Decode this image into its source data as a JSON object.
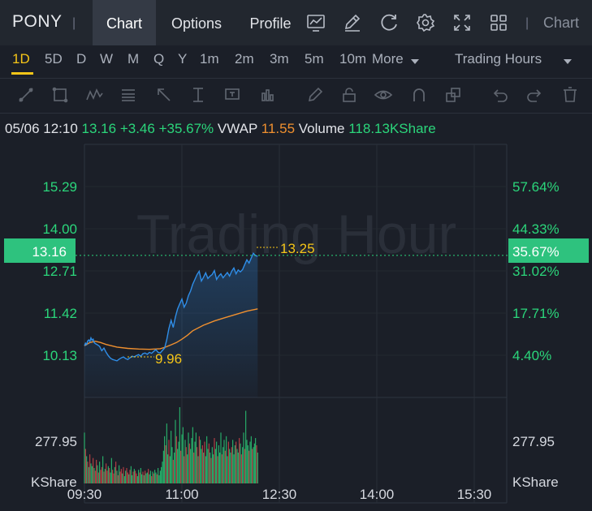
{
  "header": {
    "ticker": "PONY",
    "separator": "|",
    "tabs": [
      {
        "label": "Chart",
        "active": true
      },
      {
        "label": "Options",
        "active": false
      },
      {
        "label": "Profile",
        "active": false
      }
    ],
    "toolbar_icons": [
      "chart-indicator-icon",
      "draw-pen-icon",
      "refresh-icon",
      "settings-gear-icon",
      "fullscreen-icon",
      "layout-grid-icon"
    ],
    "right_separator": "|",
    "right_label": "Chart"
  },
  "periods": {
    "items": [
      "1D",
      "5D",
      "D",
      "W",
      "M",
      "Q",
      "Y",
      "1m",
      "2m",
      "3m",
      "5m",
      "10m"
    ],
    "active": "1D",
    "more_label": "More",
    "session_label": "Trading Hours"
  },
  "draw_tools": [
    "trend-line-icon",
    "rectangle-icon",
    "wave-pattern-icon",
    "fibonacci-icon",
    "arrow-icon",
    "price-range-icon",
    "text-note-icon",
    "measure-icon",
    "pencil-icon",
    "lock-icon",
    "visibility-eye-icon",
    "magnet-icon",
    "clone-icon",
    "undo-icon",
    "redo-icon",
    "trash-icon"
  ],
  "quote": {
    "datetime": "05/06 12:10",
    "price": "13.16",
    "change": "+3.46",
    "change_pct": "+35.67%",
    "vwap_label": "VWAP",
    "vwap_value": "11.55",
    "volume_label": "Volume",
    "volume_value": "118.13KShare"
  },
  "colors": {
    "up": "#2bd67b",
    "down": "#e0474b",
    "price_line": "#2f8ee8",
    "vwap_line": "#f0902f",
    "annotation": "#f5c518",
    "watermark": "#2a2f39"
  },
  "chart_data": {
    "type": "line",
    "watermark": "Trading Hour",
    "y_ticks_left": [
      "15.29",
      "14.00",
      "12.71",
      "11.42",
      "10.13"
    ],
    "y_ticks_right": [
      "57.64%",
      "44.33%",
      "31.02%",
      "17.71%",
      "4.40%"
    ],
    "ylim": [
      8.84,
      16.58
    ],
    "current_price_label": "13.16",
    "current_pct_label": "35.67%",
    "high_label": "13.25",
    "low_label": "9.96",
    "x_ticks": [
      "09:30",
      "11:00",
      "12:30",
      "14:00",
      "15:30"
    ],
    "x_range_minutes": [
      570,
      960
    ],
    "series": [
      {
        "name": "price",
        "x": [
          570,
          571,
          572,
          573,
          574,
          575,
          576,
          577,
          578,
          579,
          580,
          582,
          584,
          586,
          588,
          590,
          592,
          594,
          596,
          598,
          600,
          602,
          604,
          606,
          608,
          610,
          612,
          614,
          616,
          618,
          620,
          622,
          624,
          626,
          628,
          630,
          632,
          634,
          636,
          638,
          640,
          642,
          644,
          646,
          648,
          650,
          652,
          654,
          656,
          658,
          660,
          662,
          664,
          666,
          668,
          670,
          672,
          674,
          676,
          678,
          680,
          682,
          684,
          686,
          688,
          690,
          692,
          694,
          696,
          698,
          700,
          702,
          704,
          706,
          708,
          710,
          712,
          714,
          716,
          718,
          720,
          722,
          724,
          726,
          728,
          730
        ],
        "values": [
          10.42,
          10.5,
          10.46,
          10.57,
          10.6,
          10.55,
          10.66,
          10.59,
          10.62,
          10.52,
          10.49,
          10.45,
          10.4,
          10.27,
          10.35,
          10.22,
          10.12,
          10.04,
          10.0,
          9.98,
          9.96,
          10.01,
          10.05,
          10.08,
          10.03,
          10.0,
          10.05,
          10.1,
          10.08,
          10.12,
          10.15,
          10.1,
          10.18,
          10.2,
          10.16,
          10.22,
          10.19,
          10.25,
          10.3,
          10.22,
          10.2,
          10.28,
          10.35,
          10.6,
          10.95,
          11.2,
          10.98,
          11.3,
          11.55,
          11.7,
          11.85,
          11.6,
          11.72,
          11.95,
          12.1,
          12.3,
          12.45,
          12.6,
          12.7,
          12.4,
          12.52,
          12.65,
          12.48,
          12.55,
          12.6,
          12.72,
          12.45,
          12.55,
          12.62,
          12.5,
          12.58,
          12.66,
          12.55,
          12.7,
          12.8,
          12.62,
          12.74,
          12.68,
          12.75,
          12.9,
          13.05,
          12.95,
          13.1,
          13.25,
          13.18,
          13.16
        ]
      },
      {
        "name": "VWAP",
        "x": [
          570,
          575,
          580,
          585,
          590,
          600,
          610,
          620,
          630,
          640,
          645,
          650,
          655,
          660,
          665,
          670,
          680,
          690,
          700,
          710,
          720,
          730
        ],
        "values": [
          10.42,
          10.52,
          10.56,
          10.52,
          10.46,
          10.38,
          10.34,
          10.32,
          10.31,
          10.33,
          10.38,
          10.45,
          10.52,
          10.62,
          10.74,
          10.88,
          11.05,
          11.18,
          11.28,
          11.38,
          11.48,
          11.55
        ]
      }
    ],
    "volume_tick_label": "277.95",
    "volume_unit": "KShare",
    "volume": {
      "x": [
        570,
        571,
        572,
        573,
        574,
        575,
        576,
        577,
        578,
        579,
        580,
        581,
        582,
        583,
        584,
        585,
        586,
        587,
        588,
        589,
        590,
        591,
        592,
        593,
        594,
        595,
        596,
        597,
        598,
        599,
        600,
        601,
        602,
        603,
        604,
        605,
        606,
        607,
        608,
        609,
        610,
        611,
        612,
        613,
        614,
        615,
        616,
        617,
        618,
        619,
        620,
        621,
        622,
        623,
        624,
        625,
        626,
        627,
        628,
        629,
        630,
        631,
        632,
        633,
        634,
        635,
        636,
        637,
        638,
        639,
        640,
        641,
        642,
        643,
        644,
        645,
        646,
        647,
        648,
        649,
        650,
        651,
        652,
        653,
        654,
        655,
        656,
        657,
        658,
        659,
        660,
        661,
        662,
        663,
        664,
        665,
        666,
        667,
        668,
        669,
        670,
        671,
        672,
        673,
        674,
        675,
        676,
        677,
        678,
        679,
        680,
        681,
        682,
        683,
        684,
        685,
        686,
        687,
        688,
        689,
        690,
        691,
        692,
        693,
        694,
        695,
        696,
        697,
        698,
        699,
        700,
        701,
        702,
        703,
        704,
        705,
        706,
        707,
        708,
        709,
        710,
        711,
        712,
        713,
        714,
        715,
        716,
        717,
        718,
        719,
        720,
        721,
        722,
        723,
        724,
        725,
        726,
        727,
        728,
        729,
        730
      ],
      "values": [
        280,
        190,
        150,
        120,
        90,
        160,
        110,
        95,
        140,
        85,
        70,
        130,
        100,
        60,
        120,
        75,
        90,
        150,
        65,
        80,
        110,
        70,
        95,
        85,
        60,
        140,
        75,
        55,
        90,
        120,
        70,
        45,
        100,
        65,
        80,
        55,
        90,
        40,
        70,
        85,
        60,
        50,
        75,
        95,
        45,
        65,
        80,
        70,
        55,
        40,
        75,
        60,
        85,
        50,
        65,
        45,
        70,
        55,
        60,
        80,
        50,
        70,
        40,
        65,
        55,
        75,
        60,
        50,
        85,
        45,
        70,
        90,
        120,
        180,
        260,
        210,
        330,
        160,
        240,
        150,
        290,
        200,
        130,
        170,
        350,
        260,
        190,
        230,
        420,
        180,
        270,
        310,
        150,
        240,
        200,
        160,
        280,
        220,
        190,
        250,
        310,
        170,
        230,
        280,
        200,
        150,
        260,
        240,
        190,
        210,
        170,
        230,
        150,
        260,
        190,
        220,
        170,
        140,
        200,
        160,
        250,
        190,
        230,
        150,
        210,
        170,
        280,
        160,
        200,
        240,
        180,
        260,
        150,
        230,
        190,
        170,
        200,
        240,
        160,
        210,
        230,
        190,
        170,
        250,
        220,
        160,
        200,
        280,
        190,
        400,
        240,
        210,
        180,
        230,
        260,
        190,
        200,
        220,
        250,
        210,
        170
      ],
      "up": [
        true,
        false,
        true,
        false,
        true,
        false,
        true,
        true,
        false,
        true,
        false,
        false,
        true,
        false,
        true,
        false,
        false,
        true,
        false,
        true,
        false,
        false,
        true,
        false,
        true,
        true,
        false,
        false,
        true,
        false,
        true,
        false,
        true,
        false,
        false,
        true,
        false,
        true,
        true,
        false,
        false,
        true,
        false,
        true,
        true,
        false,
        true,
        false,
        false,
        true,
        true,
        false,
        true,
        true,
        false,
        true,
        false,
        true,
        true,
        false,
        true,
        true,
        false,
        true,
        false,
        true,
        true,
        false,
        true,
        true,
        true,
        true,
        true,
        true,
        true,
        false,
        true,
        true,
        false,
        true,
        true,
        true,
        false,
        true,
        true,
        false,
        true,
        true,
        true,
        false,
        true,
        true,
        false,
        true,
        false,
        true,
        true,
        false,
        true,
        true,
        true,
        false,
        true,
        true,
        false,
        true,
        false,
        true,
        true,
        false,
        true,
        false,
        true,
        true,
        true,
        false,
        true,
        false,
        true,
        true,
        false,
        true,
        true,
        false,
        true,
        true,
        true,
        false,
        true,
        true,
        false,
        true,
        true,
        false,
        true,
        true,
        false,
        true,
        true,
        true,
        false,
        true,
        true,
        false,
        true,
        false,
        true,
        true,
        false,
        true,
        true,
        true,
        false,
        true,
        true,
        false,
        true,
        true,
        true,
        false,
        true
      ]
    }
  }
}
